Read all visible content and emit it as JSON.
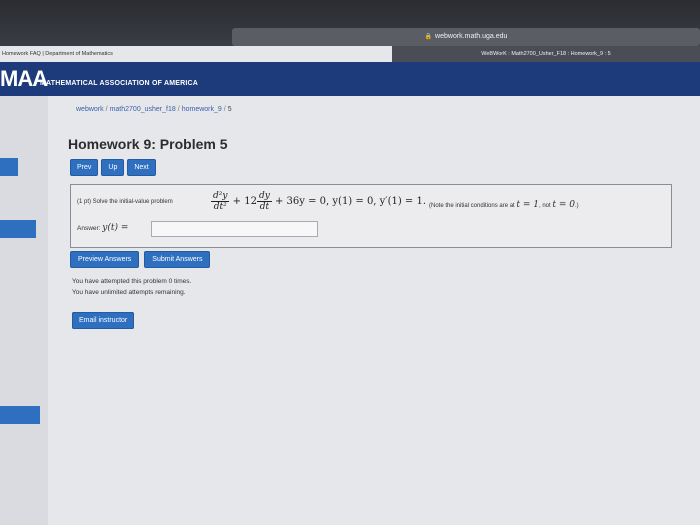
{
  "browser": {
    "url": "webwork.math.uga.edu",
    "tab_left": "Homework FAQ | Department of Mathematics",
    "tab_right": "WeBWorK : Math2700_Usher_F18 : Homework_9 : 5"
  },
  "banner": {
    "logo": "MAA",
    "org": "MATHEMATICAL ASSOCIATION OF AMERICA"
  },
  "breadcrumb": {
    "items": [
      "webwork",
      "math2700_usher_f18",
      "homework_9",
      "5"
    ],
    "sep": "/"
  },
  "page_title": "Homework 9: Problem 5",
  "nav": {
    "prev": "Prev",
    "up": "Up",
    "next": "Next"
  },
  "problem": {
    "points": "(1 pt) Solve the initial-value problem",
    "eq_num": "d²y",
    "eq_den": "dt²",
    "eq_coef": "+ 12",
    "eq_num2": "dy",
    "eq_den2": "dt",
    "eq_rest": "+ 36y = 0,  y(1) = 0,  y′(1) = 1.",
    "note_prefix": "(Note the initial conditions are at",
    "note_t1": "t = 1",
    "note_mid": ", not",
    "note_t0": "t = 0",
    "note_suffix": ".)",
    "answer_label": "Answer:",
    "answer_math": "y(t) =",
    "answer_value": ""
  },
  "actions": {
    "preview": "Preview Answers",
    "submit": "Submit Answers"
  },
  "messages": {
    "attempted": "You have attempted this problem 0 times.",
    "remaining": "You have unlimited attempts remaining."
  },
  "email_button": "Email instructor",
  "colors": {
    "banner": "#1d3a7a",
    "button": "#2f6fc0",
    "link": "#3d5fa8"
  }
}
